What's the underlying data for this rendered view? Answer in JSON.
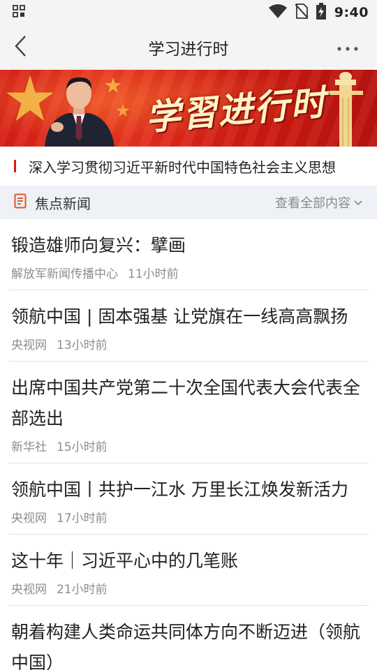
{
  "status_bar": {
    "time": "9:40",
    "icons": [
      "app-grid-icon",
      "wifi-icon",
      "no-sim-icon",
      "battery-charging-icon"
    ]
  },
  "nav": {
    "title": "学习进行时",
    "back_icon": "back-chevron-icon",
    "more_icon": "more-dots-icon"
  },
  "banner": {
    "text": "学習进行时"
  },
  "subtitle": {
    "text": "深入学习贯彻习近平新时代中国特色社会主义思想"
  },
  "section": {
    "title": "焦点新闻",
    "view_all": "查看全部内容",
    "icon": "document-icon",
    "accent_color": "#e2542c"
  },
  "news": [
    {
      "title": "锻造雄师向复兴：擘画",
      "source": "解放军新闻传播中心",
      "time": "11小时前"
    },
    {
      "title": "领航中国 | 固本强基 让党旗在一线高高飘扬",
      "source": "央视网",
      "time": "13小时前"
    },
    {
      "title": "出席中国共产党第二十次全国代表大会代表全部选出",
      "source": "新华社",
      "time": "15小时前"
    },
    {
      "title": "领航中国丨共护一江水 万里长江焕发新活力",
      "source": "央视网",
      "time": "17小时前"
    },
    {
      "title": "这十年｜习近平心中的几笔账",
      "source": "央视网",
      "time": "21小时前"
    },
    {
      "title": "朝着构建人类命运共同体方向不断迈进（领航中国）",
      "source": "",
      "time": ""
    }
  ],
  "colors": {
    "brand_red": "#d81e16",
    "header_bg": "#f4f4f4",
    "section_bg": "#eef1f5"
  }
}
